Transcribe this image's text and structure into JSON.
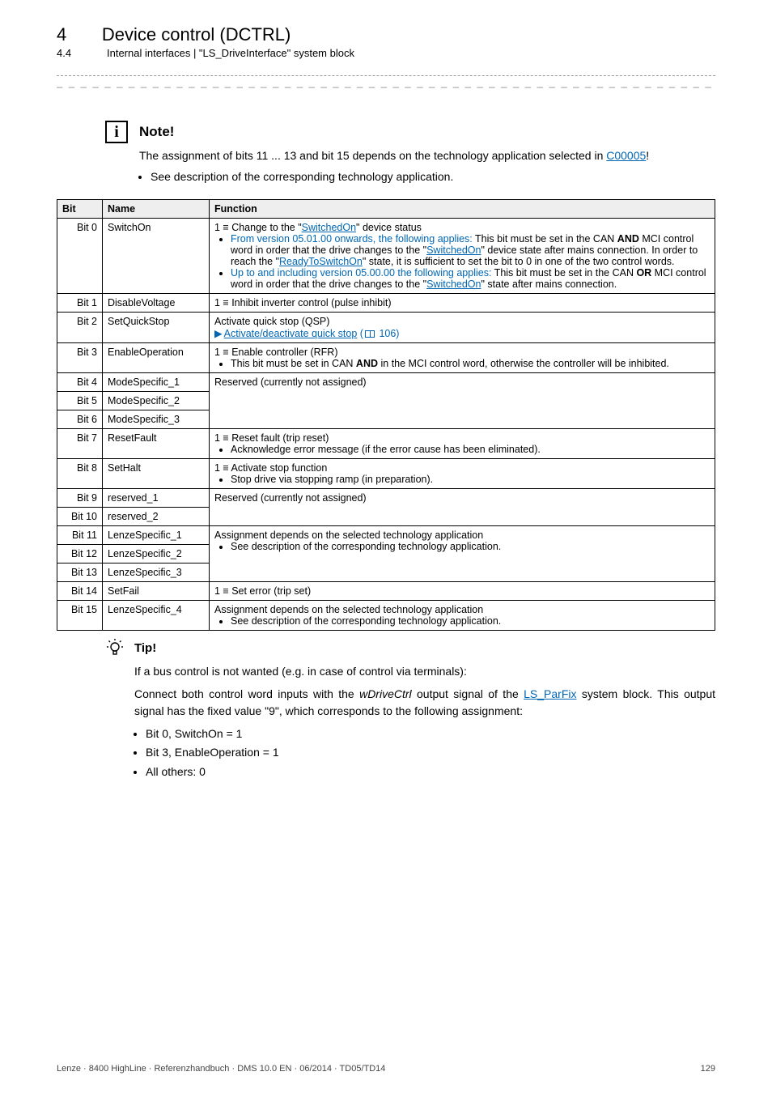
{
  "header": {
    "chapter_num": "4",
    "chapter_title": "Device control (DCTRL)",
    "section_num": "4.4",
    "section_title": "Internal interfaces | \"LS_DriveInterface\" system block"
  },
  "separator": "_ _ _ _ _ _ _ _ _ _ _ _ _ _ _ _ _ _ _ _ _ _ _ _ _ _ _ _ _ _ _ _ _ _ _ _ _ _ _ _ _ _ _ _ _ _ _ _ _ _ _ _ _ _ _ _ _ _ _ _ _ _ _ _",
  "note": {
    "title": "Note!",
    "line1_a": "The assignment of bits 11 ... 13 and bit 15 depends on the technology application selected in ",
    "link": "C00005",
    "line1_b": "!",
    "bullet": "See description of the corresponding technology application."
  },
  "table": {
    "headers": {
      "bit": "Bit",
      "name": "Name",
      "func": "Function"
    },
    "rows": {
      "r0": {
        "bit": "Bit 0",
        "name": "SwitchOn",
        "f_lead": "1 ≡ Change to the \"",
        "f_link": "SwitchedOn",
        "f_tail": "\" device status",
        "b1_lead": "From version 05.01.00 onwards, the following applies:",
        "b1_text": " This bit must be set in the CAN ",
        "b1_and": "AND",
        "b1_text2": " MCI control word in order that the drive changes to the \"",
        "b1_link1": "SwitchedOn",
        "b1_text3": "\" device state after mains connection. In order to reach the \"",
        "b1_link2": "ReadyToSwitchOn",
        "b1_text4": "\" state, it is sufficient to set the bit to 0 in one of the two control words.",
        "b2_lead": "Up to and including version 05.00.00 the following applies:",
        "b2_text": " This bit must be set in the CAN ",
        "b2_or": "OR",
        "b2_text2": " MCI control word in order that the drive changes to the \"",
        "b2_link": "SwitchedOn",
        "b2_text3": "\" state after mains connection."
      },
      "r1": {
        "bit": "Bit 1",
        "name": "DisableVoltage",
        "func": "1 ≡ Inhibit inverter control (pulse inhibit)"
      },
      "r2": {
        "bit": "Bit 2",
        "name": "SetQuickStop",
        "line1": "Activate quick stop (QSP)",
        "linktxt": "Activate/deactivate quick stop",
        "page": " 106)"
      },
      "r3": {
        "bit": "Bit 3",
        "name": "EnableOperation",
        "line1": "1 ≡ Enable controller (RFR)",
        "b1a": "This bit must be set in CAN ",
        "b1and": "AND",
        "b1b": " in the MCI control word, otherwise the controller will be inhibited."
      },
      "r4": {
        "bit": "Bit 4",
        "name": "ModeSpecific_1"
      },
      "r5": {
        "bit": "Bit 5",
        "name": "ModeSpecific_2"
      },
      "r6": {
        "bit": "Bit 6",
        "name": "ModeSpecific_3"
      },
      "r4func": "Reserved (currently not assigned)",
      "r7": {
        "bit": "Bit 7",
        "name": "ResetFault",
        "line1": "1 ≡ Reset fault (trip reset)",
        "b1": "Acknowledge error message (if the error cause has been eliminated)."
      },
      "r8": {
        "bit": "Bit 8",
        "name": "SetHalt",
        "line1": "1 ≡ Activate stop function",
        "b1": "Stop drive via stopping ramp (in preparation)."
      },
      "r9": {
        "bit": "Bit 9",
        "name": "reserved_1"
      },
      "r10": {
        "bit": "Bit 10",
        "name": "reserved_2"
      },
      "r9func": "Reserved (currently not assigned)",
      "r11": {
        "bit": "Bit 11",
        "name": "LenzeSpecific_1"
      },
      "r12": {
        "bit": "Bit 12",
        "name": "LenzeSpecific_2"
      },
      "r13": {
        "bit": "Bit 13",
        "name": "LenzeSpecific_3"
      },
      "r11func_l1": "Assignment depends on the selected technology application",
      "r11func_b1": "See description of the corresponding technology application.",
      "r14": {
        "bit": "Bit 14",
        "name": "SetFail",
        "func": "1 ≡ Set error (trip set)"
      },
      "r15": {
        "bit": "Bit 15",
        "name": "LenzeSpecific_4",
        "line1": "Assignment depends on the selected technology application",
        "b1": "See description of the corresponding technology application."
      }
    }
  },
  "tip": {
    "title": "Tip!",
    "p1": "If a bus control is not wanted (e.g. in case of control via terminals):",
    "p2a": "Connect both control word inputs with the ",
    "p2sig": "wDriveCtrl",
    "p2b": " output signal of the ",
    "p2link": "LS_ParFix",
    "p2c": " system block. This output signal has the fixed value \"9\", which corresponds to the following assignment:",
    "b1": "Bit 0, SwitchOn = 1",
    "b2": "Bit 3, EnableOperation = 1",
    "b3": "All others: 0"
  },
  "footer": {
    "left": "Lenze · 8400 HighLine · Referenzhandbuch · DMS 10.0 EN · 06/2014 · TD05/TD14",
    "right": "129"
  }
}
